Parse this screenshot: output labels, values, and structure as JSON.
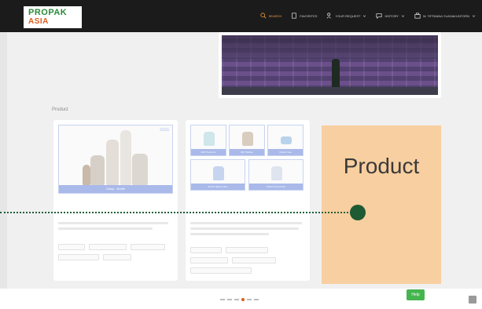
{
  "header": {
    "logo_line1": "PROPAK",
    "logo_line2": "ASIA",
    "nav": [
      {
        "label": "Search",
        "icon": "search-icon",
        "active": true
      },
      {
        "label": "Favorites",
        "icon": "bookmark-icon",
        "active": false
      },
      {
        "label": "Your request",
        "icon": "users-icon",
        "active": false
      },
      {
        "label": "History",
        "icon": "chat-icon",
        "active": false
      },
      {
        "label": "M. Tiffanna Yuasakuntorn",
        "icon": "building-icon",
        "active": false
      }
    ]
  },
  "section": {
    "title": "Product"
  },
  "cards": [
    {
      "image_caption": "Glass - Bottle",
      "badge": "GGG"
    },
    {
      "tiles": [
        "PET Preforms",
        "PET Bottles",
        "Plastic Cap",
        "Shrink Sleeve Film",
        "Stretch Hood Film"
      ]
    }
  ],
  "highlight": {
    "label": "Product"
  },
  "footer": {
    "chat_label": "Help"
  },
  "colors": {
    "header_bg": "#1b1b1b",
    "accent": "#f2a03c",
    "highlight_bg": "#f8cfa0",
    "dot": "#1e5a32",
    "chat": "#45b54f"
  }
}
